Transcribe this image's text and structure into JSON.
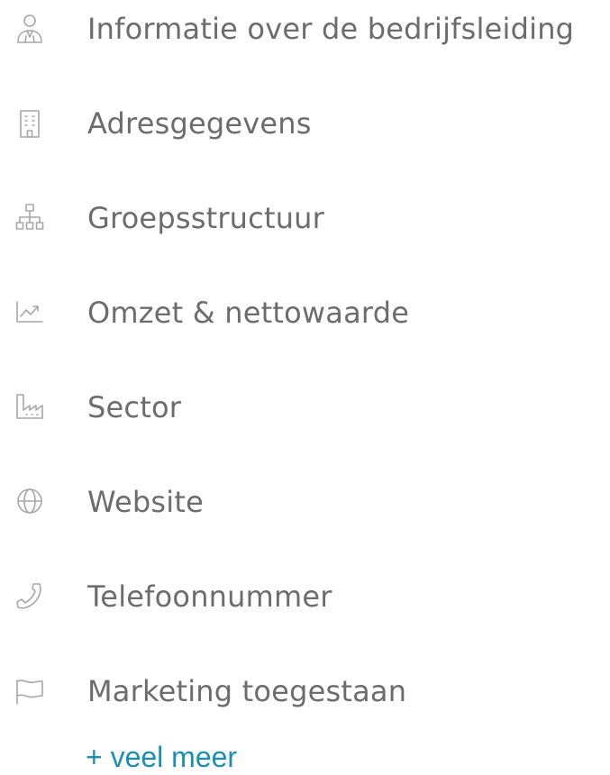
{
  "features": [
    {
      "label": "Informatie over de bedrijfsleiding",
      "icon": "management-person-icon"
    },
    {
      "label": "Adresgegevens",
      "icon": "building-icon"
    },
    {
      "label": "Groepsstructuur",
      "icon": "org-structure-icon"
    },
    {
      "label": "Omzet & nettowaarde",
      "icon": "trend-chart-icon"
    },
    {
      "label": "Sector",
      "icon": "factory-icon"
    },
    {
      "label": "Website",
      "icon": "globe-icon"
    },
    {
      "label": "Telefoonnummer",
      "icon": "phone-icon"
    },
    {
      "label": "Marketing toegestaan",
      "icon": "flag-icon"
    }
  ],
  "more_link": "+ veel meer",
  "colors": {
    "text": "#6c6c6c",
    "icon": "#a7a7a7",
    "link": "#1a8fb6"
  }
}
